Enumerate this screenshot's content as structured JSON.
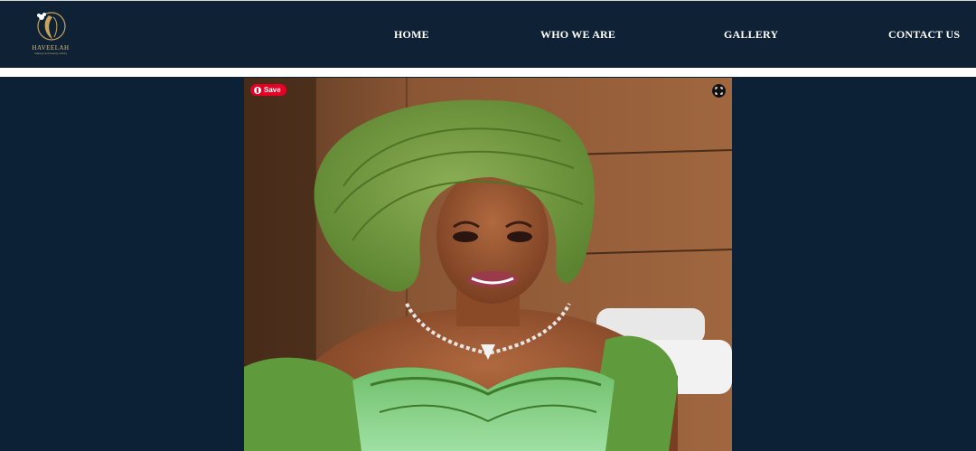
{
  "brand": {
    "name": "HAVEELAH",
    "tagline": "makeup and beauty artistry"
  },
  "nav": {
    "items": [
      {
        "label": "HOME"
      },
      {
        "label": "WHO WE ARE"
      },
      {
        "label": "GALLERY"
      },
      {
        "label": "CONTACT US"
      }
    ]
  },
  "overlay": {
    "save_label": "Save",
    "save_icon": "pinterest-icon",
    "expand_icon": "expand-icon"
  },
  "colors": {
    "header_bg": "#0e2135",
    "page_bg": "#0c2136",
    "save_red": "#e60023"
  }
}
